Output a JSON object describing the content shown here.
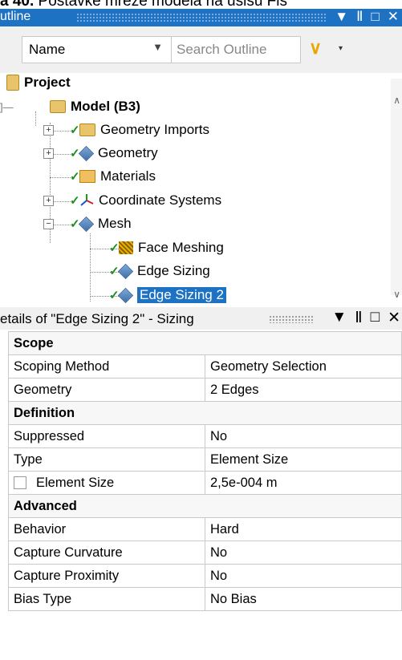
{
  "caption": {
    "prefix": "a 40.",
    "rest": "Postavke mreze modela na usisu Fis"
  },
  "outline": {
    "title": "utline",
    "controls": [
      "▼",
      "Ⅱ",
      "□",
      "✕"
    ],
    "name_select": "Name",
    "search_placeholder": "Search Outline",
    "tree": {
      "project": "Project",
      "model": "Model (B3)",
      "geometry_imports": "Geometry Imports",
      "geometry": "Geometry",
      "materials": "Materials",
      "coordinate_systems": "Coordinate Systems",
      "mesh": "Mesh",
      "face_meshing": "Face Meshing",
      "edge_sizing": "Edge Sizing",
      "edge_sizing_2": "Edge Sizing 2"
    }
  },
  "details": {
    "title": "etails of \"Edge Sizing 2\" - Sizing",
    "controls": [
      "▼",
      "Ⅱ",
      "□",
      "✕"
    ],
    "groups": {
      "scope": "Scope",
      "definition": "Definition",
      "advanced": "Advanced"
    },
    "rows": {
      "scoping_method": {
        "label": "Scoping Method",
        "value": "Geometry Selection"
      },
      "geometry": {
        "label": "Geometry",
        "value": "2 Edges"
      },
      "suppressed": {
        "label": "Suppressed",
        "value": "No"
      },
      "type": {
        "label": "Type",
        "value": "Element Size"
      },
      "element_size": {
        "label": "Element Size",
        "value": "2,5e-004 m"
      },
      "behavior": {
        "label": "Behavior",
        "value": "Hard"
      },
      "capture_curvature": {
        "label": "Capture Curvature",
        "value": "No"
      },
      "capture_proximity": {
        "label": "Capture Proximity",
        "value": "No"
      },
      "bias_type": {
        "label": "Bias Type",
        "value": "No Bias"
      }
    }
  }
}
